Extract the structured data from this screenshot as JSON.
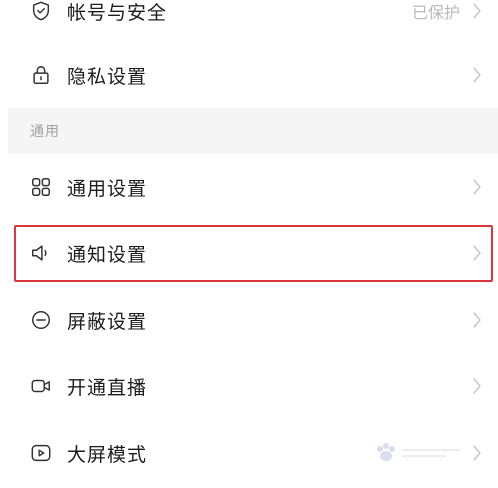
{
  "settings": {
    "items": [
      {
        "label": "帐号与安全",
        "value": "已保护",
        "icon": "shield-check-icon"
      },
      {
        "label": "隐私设置",
        "icon": "lock-icon"
      },
      {
        "label": "通用设置",
        "icon": "grid-icon"
      },
      {
        "label": "通知设置",
        "icon": "speaker-icon",
        "highlighted": true
      },
      {
        "label": "屏蔽设置",
        "icon": "block-minus-icon"
      },
      {
        "label": "开通直播",
        "icon": "video-camera-icon"
      },
      {
        "label": "大屏模式",
        "icon": "play-screen-icon"
      }
    ],
    "section_general": "通用"
  },
  "colors": {
    "highlight": "#d9363e",
    "section_bg": "#f5f5f5",
    "muted_text": "#a0a0a0"
  }
}
